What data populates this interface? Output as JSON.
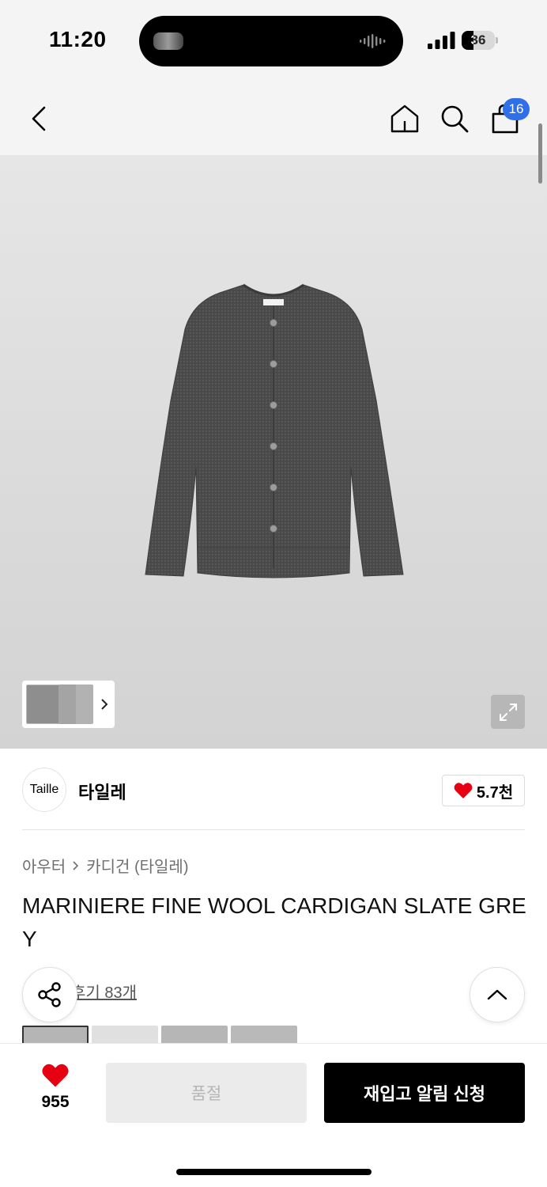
{
  "status_bar": {
    "time": "11:20",
    "battery_level": "36"
  },
  "nav": {
    "cart_count": "16",
    "icons": [
      "back-arrow-icon",
      "home-icon",
      "search-icon",
      "shopping-bag-icon"
    ]
  },
  "brand": {
    "logo_text": "Taille",
    "name": "타일레",
    "likes": "5.7천"
  },
  "breadcrumb": {
    "category": "아우터",
    "subcategory": "카디건 (타일레)"
  },
  "product": {
    "title": "MARINIERE FINE WOOL CARDIGAN SLATE GREY",
    "review_link": "후기 83개"
  },
  "swatch_colors": [
    "#b5b5b5",
    "#e0e0e0",
    "#b6b6b6",
    "#b9b9b9"
  ],
  "bottom_bar": {
    "wish_count": "955",
    "soldout_label": "품절",
    "restock_label": "재입고 알림 신청"
  },
  "colors": {
    "accent_badge": "#2f6fe8",
    "heart": "#e60012",
    "primary_button": "#000000"
  }
}
